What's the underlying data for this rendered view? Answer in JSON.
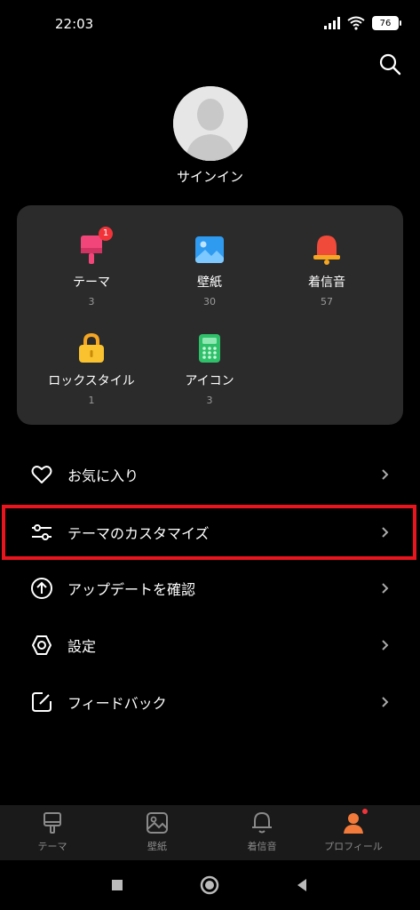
{
  "status": {
    "time": "22:03",
    "battery": "76"
  },
  "profile": {
    "sign_in": "サインイン"
  },
  "categories": [
    {
      "label": "テーマ",
      "count": "3",
      "badge": "1"
    },
    {
      "label": "壁紙",
      "count": "30"
    },
    {
      "label": "着信音",
      "count": "57"
    },
    {
      "label": "ロックスタイル",
      "count": "1"
    },
    {
      "label": "アイコン",
      "count": "3"
    }
  ],
  "menu": [
    {
      "label": "お気に入り",
      "icon": "heart-icon"
    },
    {
      "label": "テーマのカスタマイズ",
      "icon": "sliders-icon"
    },
    {
      "label": "アップデートを確認",
      "icon": "arrow-up-circle-icon"
    },
    {
      "label": "設定",
      "icon": "gear-icon"
    },
    {
      "label": "フィードバック",
      "icon": "edit-icon"
    }
  ],
  "bottom_nav": [
    {
      "label": "テーマ",
      "icon": "brush-icon"
    },
    {
      "label": "壁紙",
      "icon": "image-icon"
    },
    {
      "label": "着信音",
      "icon": "bell-icon"
    },
    {
      "label": "プロフィール",
      "icon": "person-icon"
    }
  ],
  "colors": {
    "accent": "#f27a3a",
    "highlight": "#e8141e",
    "card": "#2b2b2b"
  }
}
